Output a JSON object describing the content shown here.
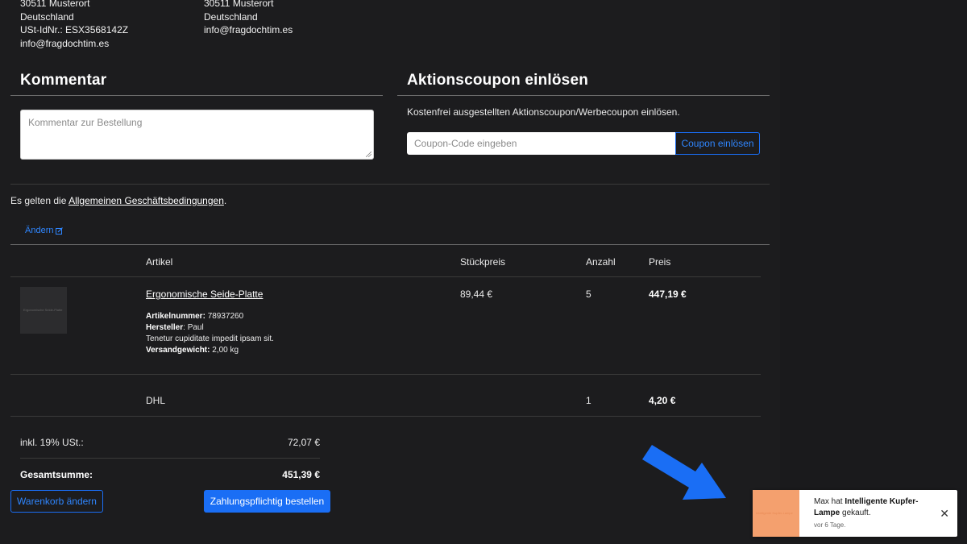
{
  "address_left": [
    "30511 Musterort",
    "Deutschland",
    "USt-IdNr.: ESX3568142Z",
    "info@fragdochtim.es"
  ],
  "address_right": [
    "30511 Musterort",
    "Deutschland",
    "info@fragdochtim.es"
  ],
  "comment": {
    "title": "Kommentar",
    "placeholder": "Kommentar zur Bestellung"
  },
  "coupon": {
    "title": "Aktionscoupon einlösen",
    "description": "Kostenfrei ausgestellten Aktionscoupon/Werbecoupon einlösen.",
    "placeholder": "Coupon-Code eingeben",
    "button": "Coupon einlösen"
  },
  "agb": {
    "prefix": "Es gelten die ",
    "link": "Allgemeinen Geschäftsbedingungen",
    "suffix": "."
  },
  "edit_link": "Ändern",
  "table": {
    "headers": [
      "Artikel",
      "Stückpreis",
      "Anzahl",
      "Preis"
    ],
    "item": {
      "thumb_text": "Ergonomische Seide-Platte",
      "name": "Ergonomische Seide-Platte",
      "artikelnummer_label": "Artikelnummer:",
      "artikelnummer": "78937260",
      "hersteller_label": "Hersteller",
      "hersteller": ": Paul",
      "description": "Tenetur cupiditate impedit ipsam sit.",
      "gewicht_label": "Versandgewicht:",
      "gewicht": "2,00 kg",
      "unit_price": "89,44 €",
      "quantity": "5",
      "price": "447,19 €"
    },
    "shipping": {
      "name": "DHL",
      "quantity": "1",
      "price": "4,20 €"
    }
  },
  "totals": {
    "tax_label": "inkl. 19% USt.:",
    "tax_value": "72,07 €",
    "sum_label": "Gesamtsumme:",
    "sum_value": "451,39 €"
  },
  "buttons": {
    "edit_cart": "Warenkorb ändern",
    "order": "Zahlungspflichtig bestellen"
  },
  "toast": {
    "prefix": "Max hat ",
    "product": "Intelligente Kupfer-Lampe",
    "suffix": " gekauft.",
    "time": "vor 6 Tage.",
    "thumb_text": "Intelligente Kupfer-Lampe"
  },
  "colors": {
    "background": "#1c1c1e",
    "accent": "#1a6ef5",
    "arrow": "#1a6ef5",
    "toast_image": "#f4a06e"
  }
}
